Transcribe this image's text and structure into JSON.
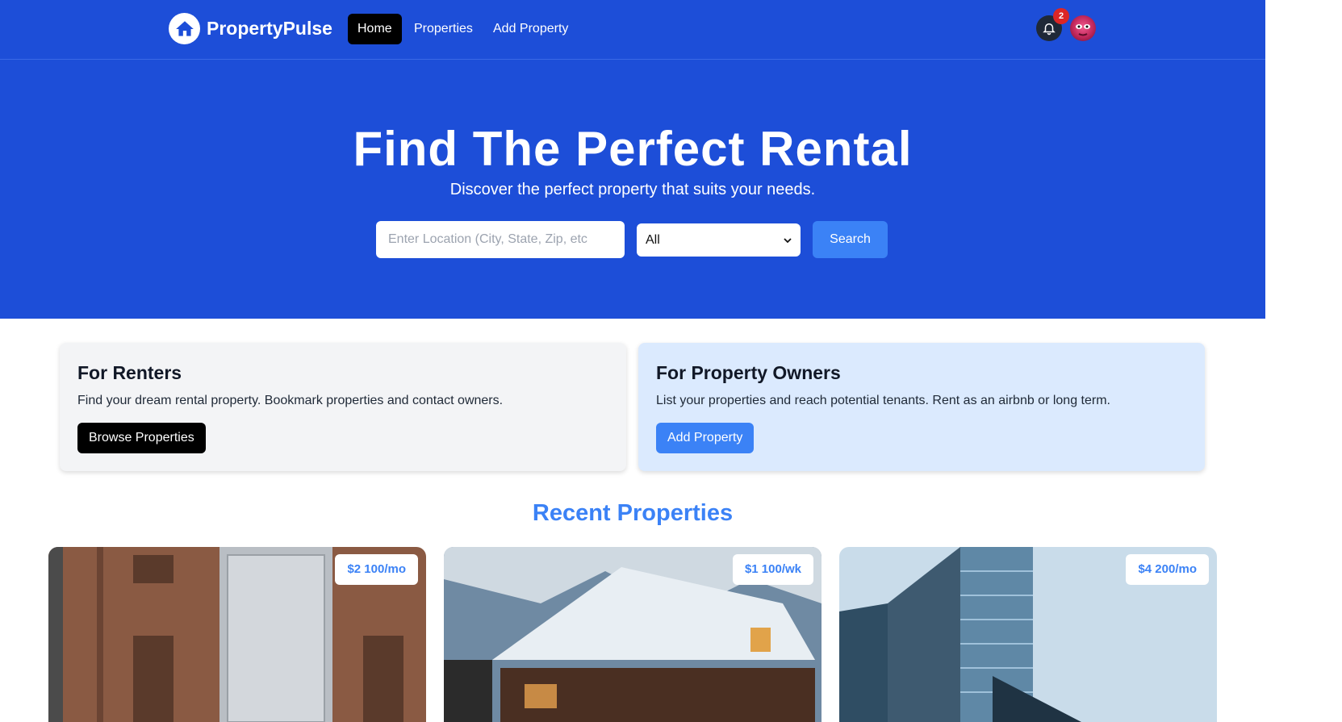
{
  "nav": {
    "logo_text": "PropertyPulse",
    "links": [
      {
        "label": "Home",
        "active": true
      },
      {
        "label": "Properties",
        "active": false
      },
      {
        "label": "Add Property",
        "active": false
      }
    ],
    "notification_count": "2"
  },
  "hero": {
    "title": "Find The Perfect Rental",
    "subtitle": "Discover the perfect property that suits your needs.",
    "location_placeholder": "Enter Location (City, State, Zip, etc",
    "type_selected": "All",
    "search_label": "Search"
  },
  "info_cards": {
    "renters": {
      "title": "For Renters",
      "text": "Find your dream rental property. Bookmark properties and contact owners.",
      "button": "Browse Properties"
    },
    "owners": {
      "title": "For Property Owners",
      "text": "List your properties and reach potential tenants. Rent as an airbnb or long term.",
      "button": "Add Property"
    }
  },
  "recent": {
    "title": "Recent Properties",
    "properties": [
      {
        "price": "$2 100/mo"
      },
      {
        "price": "$1 100/wk"
      },
      {
        "price": "$4 200/mo"
      }
    ]
  },
  "colors": {
    "brand": "#1d4ed8",
    "accent": "#3b82f6"
  }
}
